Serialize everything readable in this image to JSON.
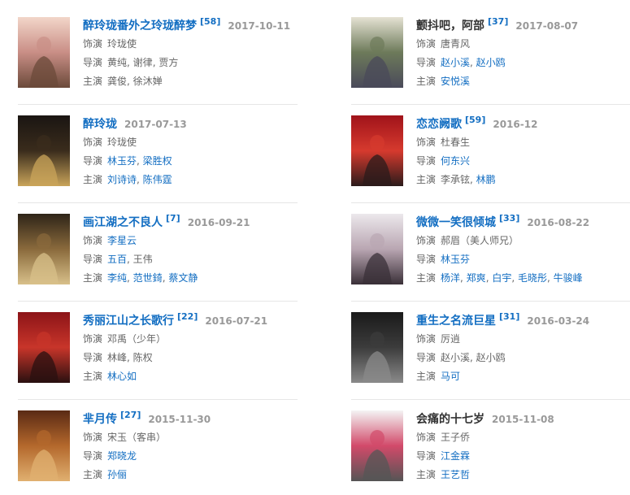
{
  "labels": {
    "role": "饰演",
    "director": "导演",
    "starring": "主演"
  },
  "works": [
    {
      "title": "醉玲珑番外之玲珑醉梦",
      "title_link": true,
      "ref": "[58]",
      "date": "2017-10-11",
      "role": [
        {
          "t": "玲珑使",
          "l": false
        }
      ],
      "director": [
        {
          "t": "黄纯",
          "l": false
        },
        {
          "t": "谢律",
          "l": false
        },
        {
          "t": "贾方",
          "l": false
        }
      ],
      "starring": [
        {
          "t": "龚俊",
          "l": false
        },
        {
          "t": "徐沐婵",
          "l": false
        }
      ],
      "colors": [
        "#f2d6c9",
        "#c98e86",
        "#6b4a3a"
      ]
    },
    {
      "title": "颤抖吧，阿部",
      "title_link": false,
      "ref": "[37]",
      "date": "2017-08-07",
      "role": [
        {
          "t": "唐青风",
          "l": false
        }
      ],
      "director": [
        {
          "t": "赵小溪",
          "l": true
        },
        {
          "t": "赵小鸥",
          "l": true
        }
      ],
      "starring": [
        {
          "t": "安悦溪",
          "l": true
        }
      ],
      "colors": [
        "#e5e2d3",
        "#6d7a5a",
        "#4a4a5a"
      ]
    },
    {
      "title": "醉玲珑",
      "title_link": true,
      "ref": "",
      "date": "2017-07-13",
      "role": [
        {
          "t": "玲珑使",
          "l": false
        }
      ],
      "director": [
        {
          "t": "林玉芬",
          "l": true
        },
        {
          "t": "梁胜权",
          "l": true
        }
      ],
      "starring": [
        {
          "t": "刘诗诗",
          "l": true
        },
        {
          "t": "陈伟霆",
          "l": true
        }
      ],
      "colors": [
        "#1a1512",
        "#3a2c1c",
        "#c9a45a"
      ]
    },
    {
      "title": "恋恋阙歌",
      "title_link": true,
      "ref": "[59]",
      "date": "2016-12",
      "role": [
        {
          "t": "杜春生",
          "l": false
        }
      ],
      "director": [
        {
          "t": "何东兴",
          "l": true
        }
      ],
      "starring": [
        {
          "t": "李承铉",
          "l": false
        },
        {
          "t": "林鹏",
          "l": true
        }
      ],
      "colors": [
        "#a0131a",
        "#d63a2e",
        "#2b1b1b"
      ]
    },
    {
      "title": "画江湖之不良人",
      "title_link": true,
      "ref": "[7]",
      "date": "2016-09-21",
      "role": [
        {
          "t": "李星云",
          "l": true
        }
      ],
      "director": [
        {
          "t": "五百",
          "l": true
        },
        {
          "t": "王伟",
          "l": false
        }
      ],
      "starring": [
        {
          "t": "李纯",
          "l": true
        },
        {
          "t": "范世錡",
          "l": true
        },
        {
          "t": "蔡文静",
          "l": true
        }
      ],
      "colors": [
        "#2e2418",
        "#8a6a3c",
        "#d8c08a"
      ]
    },
    {
      "title": "微微一笑很倾城",
      "title_link": true,
      "ref": "[33]",
      "date": "2016-08-22",
      "role": [
        {
          "t": "郝眉（美人师兄）",
          "l": false
        }
      ],
      "director": [
        {
          "t": "林玉芬",
          "l": true
        }
      ],
      "starring": [
        {
          "t": "杨洋",
          "l": true
        },
        {
          "t": "郑爽",
          "l": true
        },
        {
          "t": "白宇",
          "l": true
        },
        {
          "t": "毛晓彤",
          "l": true
        },
        {
          "t": "牛骏峰",
          "l": true
        }
      ],
      "colors": [
        "#ece8ec",
        "#b9a6b2",
        "#3a3038"
      ]
    },
    {
      "title": "秀丽江山之长歌行",
      "title_link": true,
      "ref": "[22]",
      "date": "2016-07-21",
      "role": [
        {
          "t": "邓禹（少年）",
          "l": false
        }
      ],
      "director": [
        {
          "t": "林峰",
          "l": false
        },
        {
          "t": "陈权",
          "l": false
        }
      ],
      "starring": [
        {
          "t": "林心如",
          "l": true
        }
      ],
      "colors": [
        "#8c1418",
        "#c8352a",
        "#2a1010"
      ]
    },
    {
      "title": "重生之名流巨星",
      "title_link": true,
      "ref": "[31]",
      "date": "2016-03-24",
      "role": [
        {
          "t": "厉逍",
          "l": false
        }
      ],
      "director": [
        {
          "t": "赵小溪",
          "l": false
        },
        {
          "t": "赵小鸥",
          "l": false
        }
      ],
      "starring": [
        {
          "t": "马可",
          "l": true
        }
      ],
      "colors": [
        "#1a1a1a",
        "#3c3c3c",
        "#8a8a8a"
      ]
    },
    {
      "title": "芈月传",
      "title_link": true,
      "ref": "[27]",
      "date": "2015-11-30",
      "role": [
        {
          "t": "宋玉（客串）",
          "l": false
        }
      ],
      "director": [
        {
          "t": "郑晓龙",
          "l": true
        }
      ],
      "starring": [
        {
          "t": "孙俪",
          "l": true
        }
      ],
      "colors": [
        "#5a2a14",
        "#b4682c",
        "#e0b070"
      ]
    },
    {
      "title": "会痛的十七岁",
      "title_link": false,
      "ref": "",
      "date": "2015-11-08",
      "role": [
        {
          "t": "王子侨",
          "l": false
        }
      ],
      "director": [
        {
          "t": "江金霖",
          "l": true
        }
      ],
      "starring": [
        {
          "t": "王艺哲",
          "l": true
        }
      ],
      "colors": [
        "#f4f4f4",
        "#d24a6a",
        "#555555"
      ]
    }
  ]
}
